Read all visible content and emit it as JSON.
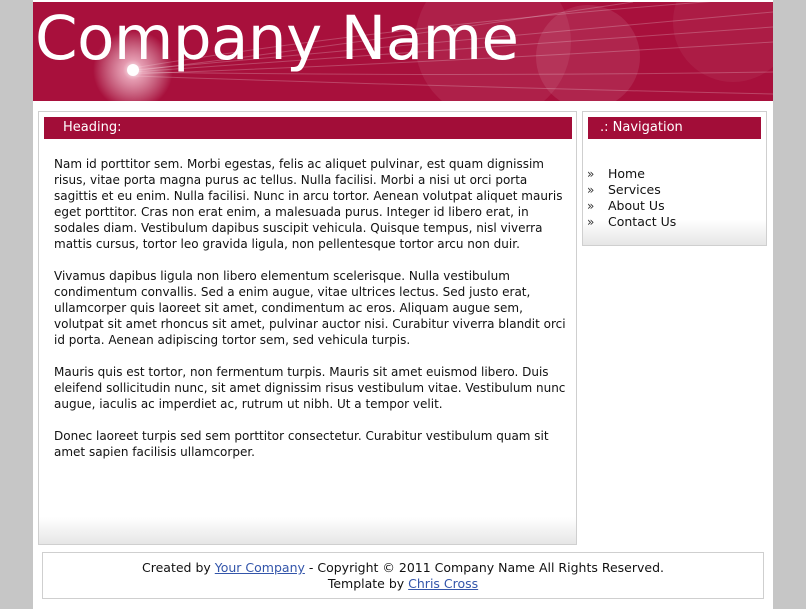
{
  "header": {
    "site_title": "Company Name"
  },
  "main": {
    "heading": "Heading:",
    "paragraphs": [
      "Nam id porttitor sem. Morbi egestas, felis ac aliquet pulvinar, est quam dignissim risus, vitae porta magna purus ac tellus. Nulla facilisi. Morbi a nisi ut orci porta sagittis et eu enim. Nulla facilisi. Nunc in arcu tortor. Aenean volutpat aliquet mauris eget porttitor. Cras non erat enim, a malesuada purus. Integer id libero erat, in sodales diam. Vestibulum dapibus suscipit vehicula. Quisque tempus, nisl viverra mattis cursus, tortor leo gravida ligula, non pellentesque tortor arcu non duir.",
      "Vivamus dapibus ligula non libero elementum scelerisque. Nulla vestibulum condimentum convallis. Sed a enim augue, vitae ultrices lectus. Sed justo erat, ullamcorper quis laoreet sit amet, condimentum ac eros. Aliquam augue sem, volutpat sit amet rhoncus sit amet, pulvinar auctor nisi. Curabitur viverra blandit orci id porta. Aenean adipiscing tortor sem, sed vehicula turpis.",
      "Mauris quis est tortor, non fermentum turpis. Mauris sit amet euismod libero. Duis eleifend sollicitudin nunc, sit amet dignissim risus vestibulum vitae. Vestibulum nunc augue, iaculis ac imperdiet ac, rutrum ut nibh. Ut a tempor velit.",
      "Donec laoreet turpis sed sem porttitor consectetur. Curabitur vestibulum quam sit amet sapien facilisis ullamcorper."
    ]
  },
  "sidebar": {
    "heading": ".: Navigation",
    "arrow_glyph": "»",
    "items": [
      {
        "label": "Home"
      },
      {
        "label": "Services"
      },
      {
        "label": "About Us"
      },
      {
        "label": "Contact Us"
      }
    ]
  },
  "footer": {
    "created_by": "Created by",
    "company_link": "Your Company",
    "copyright": "- Copyright © 2011 Company Name All Rights Reserved.",
    "template_by": "Template by",
    "author_link": "Chris Cross"
  },
  "colors": {
    "brand": "#a8103c",
    "bar": "#a20d38",
    "page_background": "#c6c6c6",
    "link": "#3355aa"
  }
}
